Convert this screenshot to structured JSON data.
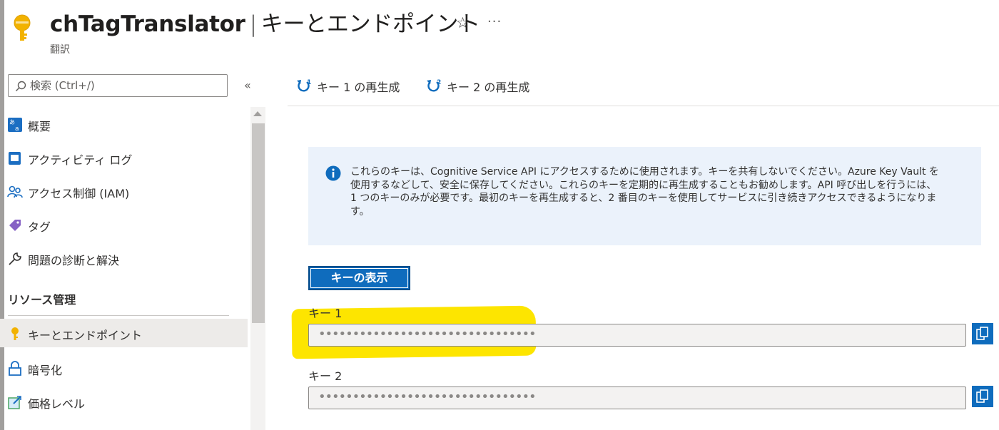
{
  "header": {
    "resource_name": "chTagTranslator",
    "separator": "|",
    "page_name": "キーとエンドポイント",
    "subtitle": "翻訳",
    "favorite_glyph": "☆",
    "more_glyph": "···"
  },
  "sidebar": {
    "search_placeholder": "検索 (Ctrl+/)",
    "collapse_glyph": "«",
    "items": [
      {
        "label": "概要",
        "icon": "translator-overview-icon"
      },
      {
        "label": "アクティビティ ログ",
        "icon": "activity-log-icon"
      },
      {
        "label": "アクセス制御 (IAM)",
        "icon": "people-icon"
      },
      {
        "label": "タグ",
        "icon": "tag-icon"
      },
      {
        "label": "問題の診断と解決",
        "icon": "wrench-icon"
      }
    ],
    "section_header": "リソース管理",
    "resource_items": [
      {
        "label": "キーとエンドポイント",
        "icon": "key-icon",
        "active": true
      },
      {
        "label": "暗号化",
        "icon": "lock-icon"
      },
      {
        "label": "価格レベル",
        "icon": "edit-square-icon"
      }
    ]
  },
  "toolbar": {
    "regen_key1": "キー 1 の再生成",
    "regen_key2": "キー 2 の再生成"
  },
  "info": {
    "text": "これらのキーは、Cognitive Service API にアクセスするために使用されます。キーを共有しないでください。Azure Key Vault を\n使用するなどして、安全に保存してください。これらのキーを定期的に再生成することもお勧めします。API 呼び出しを行うには、\n1 つのキーのみが必要です。最初のキーを再生成すると、2 番目のキーを使用してサービスに引き続きアクセスできるようになりま\nす。"
  },
  "show_keys_button": "キーの表示",
  "keys": [
    {
      "label": "キー 1",
      "value": "••••••••••••••••••••••••••••••••"
    },
    {
      "label": "キー 2",
      "value": "••••••••••••••••••••••••••••••••"
    }
  ],
  "colors": {
    "accent": "#0f6cbd",
    "highlight": "#fde500",
    "info_background": "#ebf2fb",
    "key_icon": "#f2b200"
  }
}
